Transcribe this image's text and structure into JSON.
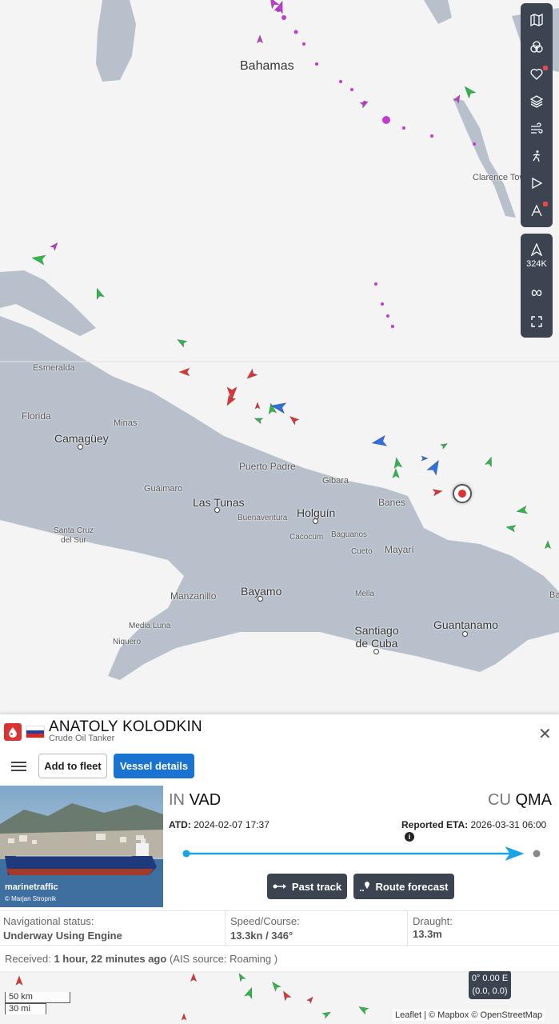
{
  "map": {
    "places": [
      {
        "name": "Bahamas",
        "size": "xl"
      },
      {
        "name": "Clarence Town",
        "size": "sm"
      },
      {
        "name": "Esmeralda",
        "size": "sm"
      },
      {
        "name": "Florida",
        "size": "md"
      },
      {
        "name": "Minas",
        "size": "sm"
      },
      {
        "name": "Camagüey",
        "size": "big"
      },
      {
        "name": "Puerto Padre",
        "size": "md"
      },
      {
        "name": "Gibara",
        "size": "sm"
      },
      {
        "name": "Guáimaro",
        "size": "sm"
      },
      {
        "name": "Banes",
        "size": "md"
      },
      {
        "name": "Las Tunas",
        "size": "big"
      },
      {
        "name": "Holguín",
        "size": "big"
      },
      {
        "name": "Buenaventura",
        "size": "sm"
      },
      {
        "name": "Santa Cruz del Sur",
        "size": "sm"
      },
      {
        "name": "Cacocum",
        "size": "sm"
      },
      {
        "name": "Baguanos",
        "size": "sm"
      },
      {
        "name": "Cueto",
        "size": "sm"
      },
      {
        "name": "Mayarí",
        "size": "md"
      },
      {
        "name": "Manzanillo",
        "size": "md"
      },
      {
        "name": "Bayamo",
        "size": "big"
      },
      {
        "name": "Mella",
        "size": "sm"
      },
      {
        "name": "Media Luna",
        "size": "sm"
      },
      {
        "name": "Niquero",
        "size": "sm"
      },
      {
        "name": "Santiago de Cuba",
        "size": "big"
      },
      {
        "name": "Guantanamo",
        "size": "big"
      },
      {
        "name": "Ba",
        "size": "sm"
      }
    ],
    "toolbar": [
      "map-icon",
      "filters-icon",
      "favourite-icon",
      "layers-icon",
      "weather-icon",
      "measure-icon",
      "play-icon",
      "routes-icon"
    ],
    "vessel_count": "324K",
    "coords_line1": "0° 0.00 E",
    "coords_line2": "(0.0, 0.0)",
    "scale_km": "50 km",
    "scale_mi": "30 mi",
    "attribution": "Leaflet | © Mapbox © OpenStreetMap"
  },
  "vessel": {
    "name": "ANATOLY KOLODKIN",
    "type": "Crude Oil Tanker",
    "add_to_fleet": "Add to fleet",
    "vessel_details": "Vessel details",
    "photo_brand": "marinetraffic",
    "photo_credit": "© Marjan Stropnik",
    "from_cc": "IN",
    "from_port": "VAD",
    "to_cc": "CU",
    "to_port": "QMA",
    "atd_label": "ATD:",
    "atd_value": "2024-02-07 17:37",
    "eta_label": "Reported ETA:",
    "eta_value": "2026-03-31 06:00",
    "progress": 0.96,
    "past_track": "Past track",
    "route_forecast": "Route forecast",
    "nav_status_label": "Navigational status:",
    "nav_status_value": "Underway Using Engine",
    "speed_label": "Speed/Course:",
    "speed_value": "13.3kn / 346°",
    "draught_label": "Draught:",
    "draught_value": "13.3m",
    "received_label": "Received:",
    "received_value": "1 hour, 22 minutes ago",
    "ais_source": "(AIS source: Roaming )"
  },
  "colors": {
    "accent": "#1a73d1",
    "land": "#b7c0cb",
    "sea": "#f4f4f4",
    "toolbar": "#3b4450",
    "track": "#1aa3e8",
    "tanker": "#d93333"
  }
}
